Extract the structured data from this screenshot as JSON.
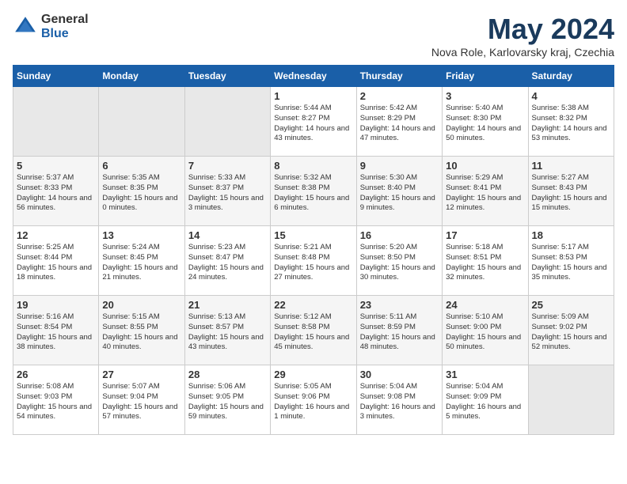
{
  "header": {
    "logo_general": "General",
    "logo_blue": "Blue",
    "month_title": "May 2024",
    "subtitle": "Nova Role, Karlovarsky kraj, Czechia"
  },
  "calendar": {
    "days_of_week": [
      "Sunday",
      "Monday",
      "Tuesday",
      "Wednesday",
      "Thursday",
      "Friday",
      "Saturday"
    ],
    "weeks": [
      [
        {
          "day": "",
          "info": "",
          "empty": true
        },
        {
          "day": "",
          "info": "",
          "empty": true
        },
        {
          "day": "",
          "info": "",
          "empty": true
        },
        {
          "day": "1",
          "info": "Sunrise: 5:44 AM\nSunset: 8:27 PM\nDaylight: 14 hours\nand 43 minutes.",
          "empty": false
        },
        {
          "day": "2",
          "info": "Sunrise: 5:42 AM\nSunset: 8:29 PM\nDaylight: 14 hours\nand 47 minutes.",
          "empty": false
        },
        {
          "day": "3",
          "info": "Sunrise: 5:40 AM\nSunset: 8:30 PM\nDaylight: 14 hours\nand 50 minutes.",
          "empty": false
        },
        {
          "day": "4",
          "info": "Sunrise: 5:38 AM\nSunset: 8:32 PM\nDaylight: 14 hours\nand 53 minutes.",
          "empty": false
        }
      ],
      [
        {
          "day": "5",
          "info": "Sunrise: 5:37 AM\nSunset: 8:33 PM\nDaylight: 14 hours\nand 56 minutes.",
          "empty": false
        },
        {
          "day": "6",
          "info": "Sunrise: 5:35 AM\nSunset: 8:35 PM\nDaylight: 15 hours\nand 0 minutes.",
          "empty": false
        },
        {
          "day": "7",
          "info": "Sunrise: 5:33 AM\nSunset: 8:37 PM\nDaylight: 15 hours\nand 3 minutes.",
          "empty": false
        },
        {
          "day": "8",
          "info": "Sunrise: 5:32 AM\nSunset: 8:38 PM\nDaylight: 15 hours\nand 6 minutes.",
          "empty": false
        },
        {
          "day": "9",
          "info": "Sunrise: 5:30 AM\nSunset: 8:40 PM\nDaylight: 15 hours\nand 9 minutes.",
          "empty": false
        },
        {
          "day": "10",
          "info": "Sunrise: 5:29 AM\nSunset: 8:41 PM\nDaylight: 15 hours\nand 12 minutes.",
          "empty": false
        },
        {
          "day": "11",
          "info": "Sunrise: 5:27 AM\nSunset: 8:43 PM\nDaylight: 15 hours\nand 15 minutes.",
          "empty": false
        }
      ],
      [
        {
          "day": "12",
          "info": "Sunrise: 5:25 AM\nSunset: 8:44 PM\nDaylight: 15 hours\nand 18 minutes.",
          "empty": false
        },
        {
          "day": "13",
          "info": "Sunrise: 5:24 AM\nSunset: 8:45 PM\nDaylight: 15 hours\nand 21 minutes.",
          "empty": false
        },
        {
          "day": "14",
          "info": "Sunrise: 5:23 AM\nSunset: 8:47 PM\nDaylight: 15 hours\nand 24 minutes.",
          "empty": false
        },
        {
          "day": "15",
          "info": "Sunrise: 5:21 AM\nSunset: 8:48 PM\nDaylight: 15 hours\nand 27 minutes.",
          "empty": false
        },
        {
          "day": "16",
          "info": "Sunrise: 5:20 AM\nSunset: 8:50 PM\nDaylight: 15 hours\nand 30 minutes.",
          "empty": false
        },
        {
          "day": "17",
          "info": "Sunrise: 5:18 AM\nSunset: 8:51 PM\nDaylight: 15 hours\nand 32 minutes.",
          "empty": false
        },
        {
          "day": "18",
          "info": "Sunrise: 5:17 AM\nSunset: 8:53 PM\nDaylight: 15 hours\nand 35 minutes.",
          "empty": false
        }
      ],
      [
        {
          "day": "19",
          "info": "Sunrise: 5:16 AM\nSunset: 8:54 PM\nDaylight: 15 hours\nand 38 minutes.",
          "empty": false
        },
        {
          "day": "20",
          "info": "Sunrise: 5:15 AM\nSunset: 8:55 PM\nDaylight: 15 hours\nand 40 minutes.",
          "empty": false
        },
        {
          "day": "21",
          "info": "Sunrise: 5:13 AM\nSunset: 8:57 PM\nDaylight: 15 hours\nand 43 minutes.",
          "empty": false
        },
        {
          "day": "22",
          "info": "Sunrise: 5:12 AM\nSunset: 8:58 PM\nDaylight: 15 hours\nand 45 minutes.",
          "empty": false
        },
        {
          "day": "23",
          "info": "Sunrise: 5:11 AM\nSunset: 8:59 PM\nDaylight: 15 hours\nand 48 minutes.",
          "empty": false
        },
        {
          "day": "24",
          "info": "Sunrise: 5:10 AM\nSunset: 9:00 PM\nDaylight: 15 hours\nand 50 minutes.",
          "empty": false
        },
        {
          "day": "25",
          "info": "Sunrise: 5:09 AM\nSunset: 9:02 PM\nDaylight: 15 hours\nand 52 minutes.",
          "empty": false
        }
      ],
      [
        {
          "day": "26",
          "info": "Sunrise: 5:08 AM\nSunset: 9:03 PM\nDaylight: 15 hours\nand 54 minutes.",
          "empty": false
        },
        {
          "day": "27",
          "info": "Sunrise: 5:07 AM\nSunset: 9:04 PM\nDaylight: 15 hours\nand 57 minutes.",
          "empty": false
        },
        {
          "day": "28",
          "info": "Sunrise: 5:06 AM\nSunset: 9:05 PM\nDaylight: 15 hours\nand 59 minutes.",
          "empty": false
        },
        {
          "day": "29",
          "info": "Sunrise: 5:05 AM\nSunset: 9:06 PM\nDaylight: 16 hours\nand 1 minute.",
          "empty": false
        },
        {
          "day": "30",
          "info": "Sunrise: 5:04 AM\nSunset: 9:08 PM\nDaylight: 16 hours\nand 3 minutes.",
          "empty": false
        },
        {
          "day": "31",
          "info": "Sunrise: 5:04 AM\nSunset: 9:09 PM\nDaylight: 16 hours\nand 5 minutes.",
          "empty": false
        },
        {
          "day": "",
          "info": "",
          "empty": true
        }
      ]
    ]
  }
}
